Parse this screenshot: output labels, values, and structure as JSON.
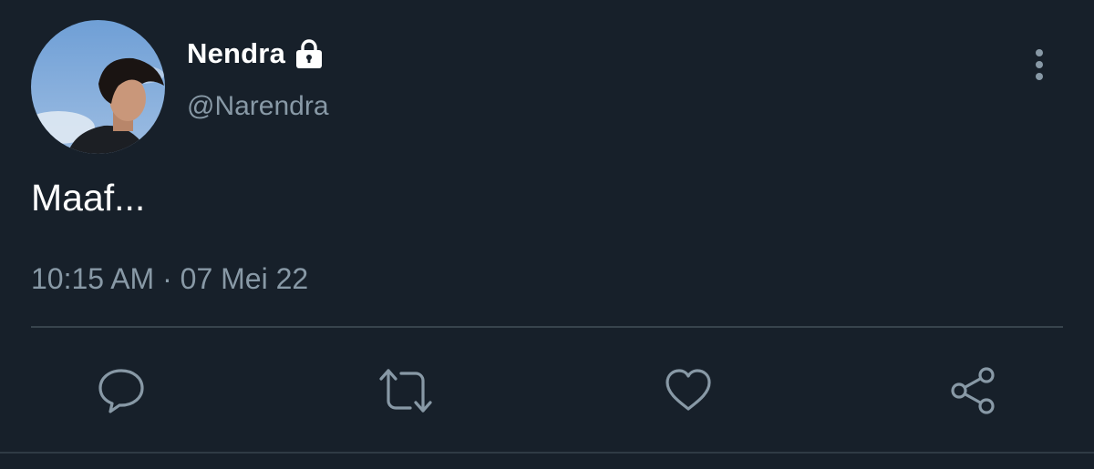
{
  "user": {
    "display_name": "Nendra",
    "handle": "@Narendra",
    "protected_icon": "lock-icon",
    "avatar": "profile-photo"
  },
  "tweet": {
    "text": "Maaf...",
    "timestamp": "10:15 AM · 07 Mei 22"
  },
  "menu_icon": "more-vertical-icon",
  "actions": [
    {
      "name": "reply",
      "icon": "reply-icon"
    },
    {
      "name": "retweet",
      "icon": "retweet-icon"
    },
    {
      "name": "like",
      "icon": "heart-icon"
    },
    {
      "name": "share",
      "icon": "share-icon"
    }
  ],
  "colors": {
    "background": "#17202a",
    "primary_text": "#ffffff",
    "secondary_text": "#8899a6",
    "divider": "#38444d"
  }
}
